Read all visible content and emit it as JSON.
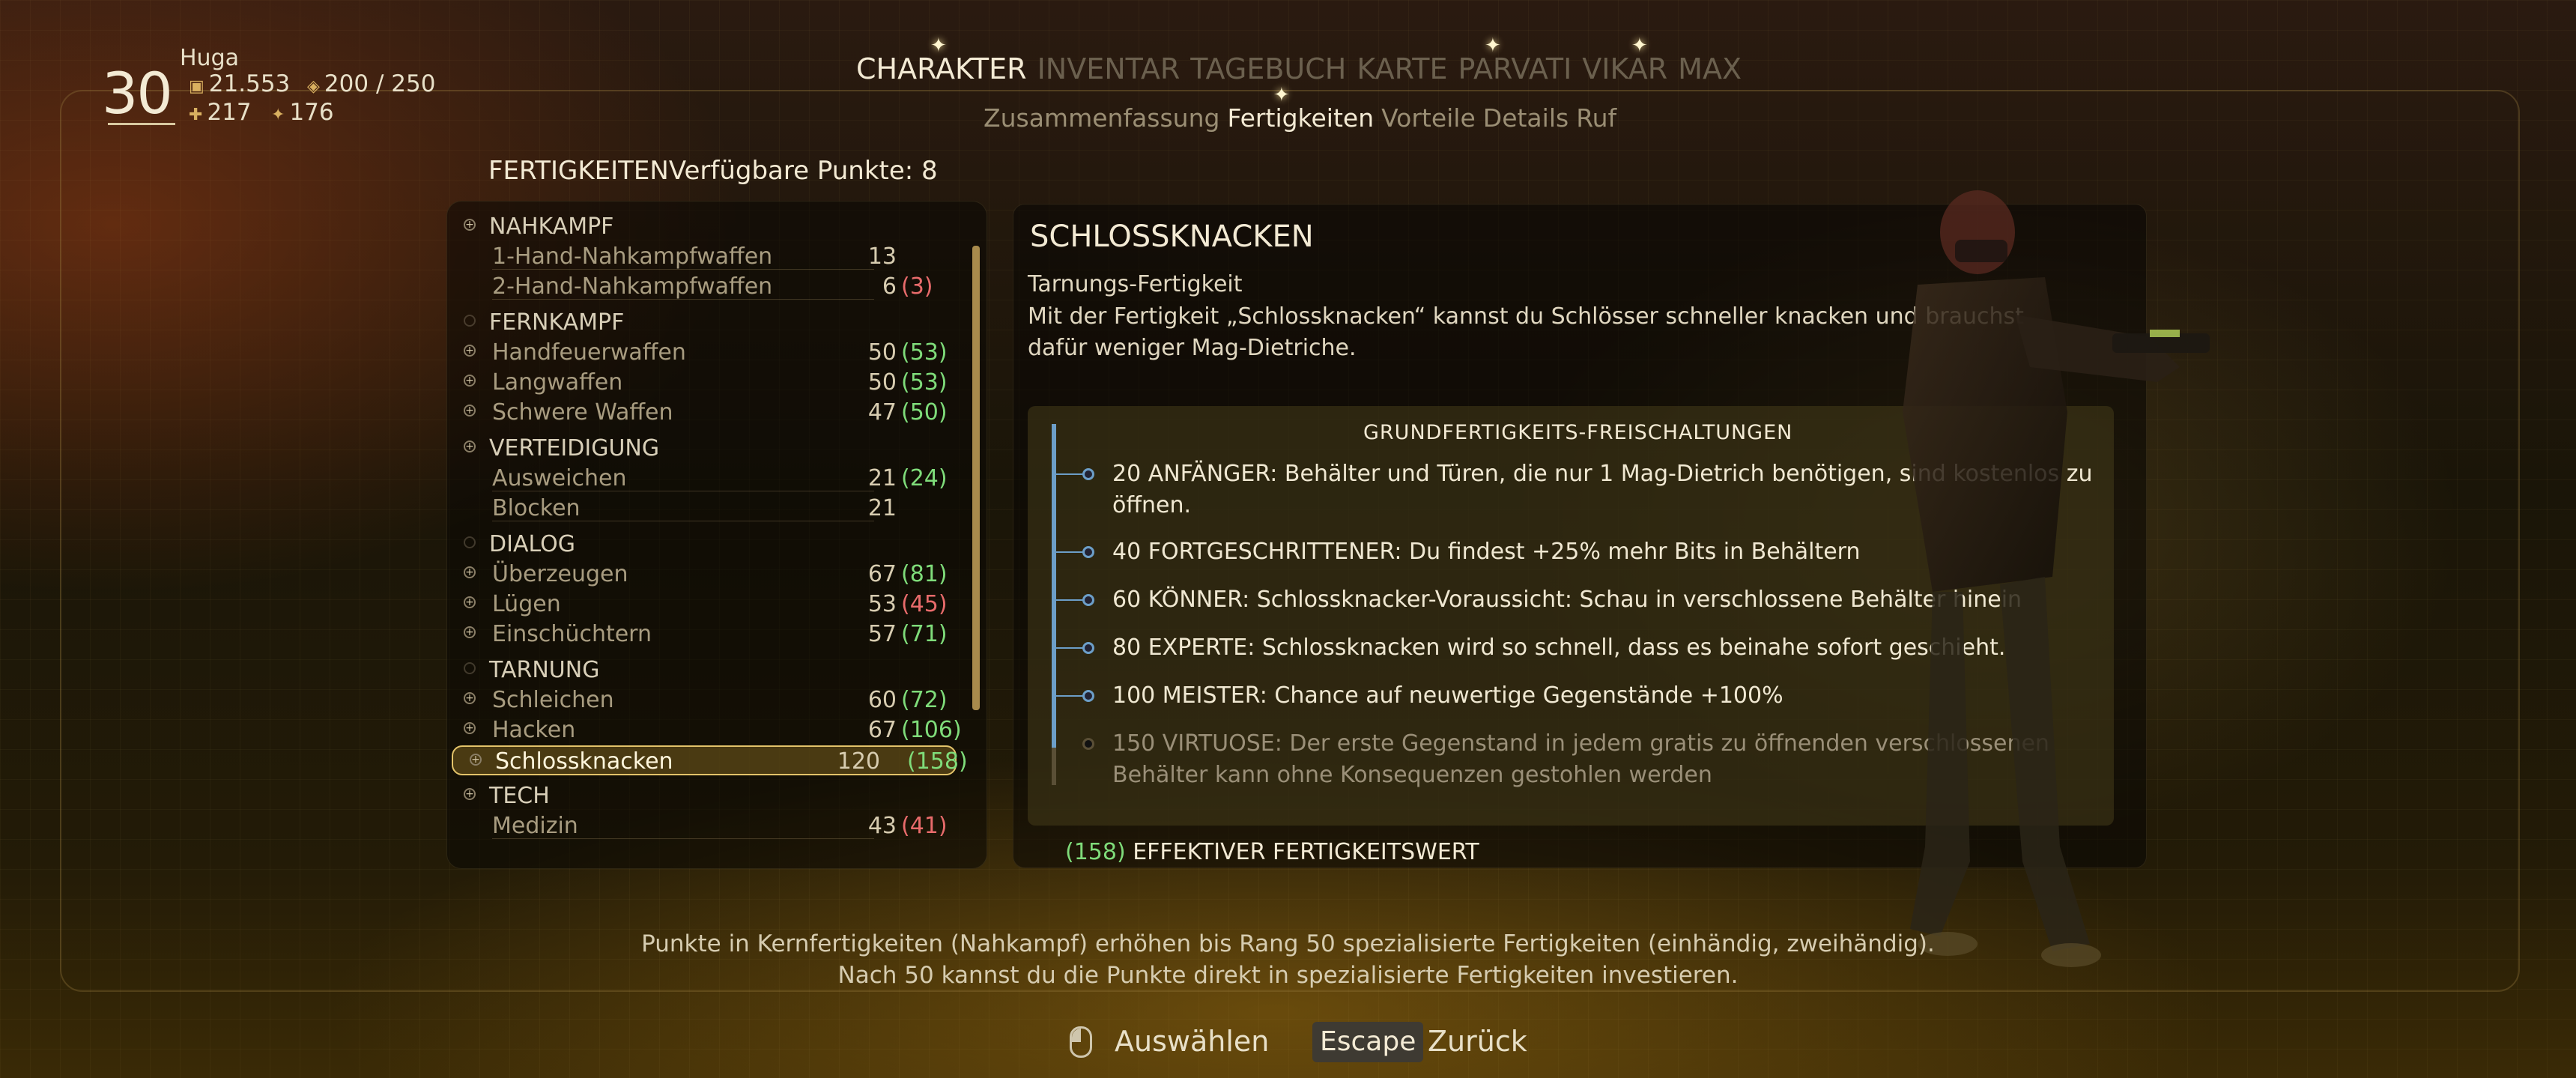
{
  "player": {
    "level": "30",
    "name": "Huga",
    "bits": "21.553",
    "carry": "200 / 250",
    "stat_a": "217",
    "stat_b": "176"
  },
  "tabs": [
    "CHARAKTER",
    "INVENTAR",
    "TAGEBUCH",
    "KARTE",
    "PARVATI",
    "VIKAR",
    "MAX"
  ],
  "subtabs": [
    "Zusammenfassung",
    "Fertigkeiten",
    "Vorteile",
    "Details",
    "Ruf"
  ],
  "skills_panel": {
    "title": "FERTIGKEITEN",
    "points_label": "Verfügbare Punkte: 8"
  },
  "skill_rows": [
    {
      "type": "cat",
      "label": "NAHKAMPF",
      "dot": "plus"
    },
    {
      "type": "sub",
      "label": "1-Hand-Nahkampfwaffen",
      "value": "13",
      "eff": ""
    },
    {
      "type": "sub",
      "label": "2-Hand-Nahkampfwaffen",
      "value": "6",
      "eff": "(3)",
      "eff_color": "red"
    },
    {
      "type": "cat",
      "label": "FERNKAMPF",
      "dot": "empty"
    },
    {
      "type": "item",
      "label": "Handfeuerwaffen",
      "value": "50",
      "eff": "(53)",
      "eff_color": "green"
    },
    {
      "type": "item",
      "label": "Langwaffen",
      "value": "50",
      "eff": "(53)",
      "eff_color": "green"
    },
    {
      "type": "item",
      "label": "Schwere Waffen",
      "value": "47",
      "eff": "(50)",
      "eff_color": "green"
    },
    {
      "type": "cat",
      "label": "VERTEIDIGUNG",
      "dot": "plus"
    },
    {
      "type": "sub",
      "label": "Ausweichen",
      "value": "21",
      "eff": "(24)",
      "eff_color": "green"
    },
    {
      "type": "sub",
      "label": "Blocken",
      "value": "21",
      "eff": ""
    },
    {
      "type": "cat",
      "label": "DIALOG",
      "dot": "empty"
    },
    {
      "type": "item",
      "label": "Überzeugen",
      "value": "67",
      "eff": "(81)",
      "eff_color": "green"
    },
    {
      "type": "item",
      "label": "Lügen",
      "value": "53",
      "eff": "(45)",
      "eff_color": "red"
    },
    {
      "type": "item",
      "label": "Einschüchtern",
      "value": "57",
      "eff": "(71)",
      "eff_color": "green"
    },
    {
      "type": "cat",
      "label": "TARNUNG",
      "dot": "empty"
    },
    {
      "type": "item",
      "label": "Schleichen",
      "value": "60",
      "eff": "(72)",
      "eff_color": "green"
    },
    {
      "type": "item",
      "label": "Hacken",
      "value": "67",
      "eff": "(106)",
      "eff_color": "green"
    },
    {
      "type": "selected",
      "label": "Schlossknacken",
      "value": "120",
      "eff": "(158)",
      "eff_color": "green"
    },
    {
      "type": "cat",
      "label": "TECH",
      "dot": "plus"
    },
    {
      "type": "sub",
      "label": "Medizin",
      "value": "43",
      "eff": "(41)",
      "eff_color": "red"
    }
  ],
  "detail": {
    "title": "SCHLOSSKNACKEN",
    "subtitle": "Tarnungs-Fertigkeit",
    "description": "Mit der Fertigkeit „Schlossknacken“ kannst du Schlösser schneller knacken und brauchst dafür weniger Mag-Dietriche.",
    "unlocks_title": "GRUNDFERTIGKEITS-FREISCHALTUNGEN",
    "unlocks": [
      {
        "text": "20 ANFÄNGER: Behälter und Türen, die nur 1 Mag-Dietrich benötigen, sind kostenlos zu öffnen.",
        "locked": false
      },
      {
        "text": "40 FORTGESCHRITTENER: Du findest +25% mehr Bits in Behältern",
        "locked": false
      },
      {
        "text": "60 KÖNNER: Schlossknacker-Voraussicht: Schau in verschlossene Behälter hinein",
        "locked": false
      },
      {
        "text": "80 EXPERTE: Schlossknacken wird so schnell, dass es beinahe sofort geschieht.",
        "locked": false
      },
      {
        "text": "100 MEISTER: Chance auf neuwertige Gegenstände +100%",
        "locked": false
      },
      {
        "text": "150 VIRTUOSE: Der erste Gegenstand in jedem gratis zu öffnenden verschlossenen Behälter kann ohne Konsequenzen gestohlen werden",
        "locked": true
      }
    ],
    "effective_value": "(158)",
    "effective_label": "EFFEKTIVER FERTIGKEITSWERT"
  },
  "footer": {
    "hint_line1": "Punkte in Kernfertigkeiten (Nahkampf) erhöhen bis Rang 50 spezialisierte Fertigkeiten (einhändig, zweihändig).",
    "hint_line2": "Nach 50 kannst du die Punkte direkt in spezialisierte Fertigkeiten investieren.",
    "select_label": "Auswählen",
    "escape_key": "Escape",
    "back_label": "Zurück"
  },
  "colors": {
    "accent_gold": "#e3c36a",
    "positive": "#7fdc7a",
    "negative": "#e86b6b",
    "timeline_blue": "#6c9ec8"
  }
}
